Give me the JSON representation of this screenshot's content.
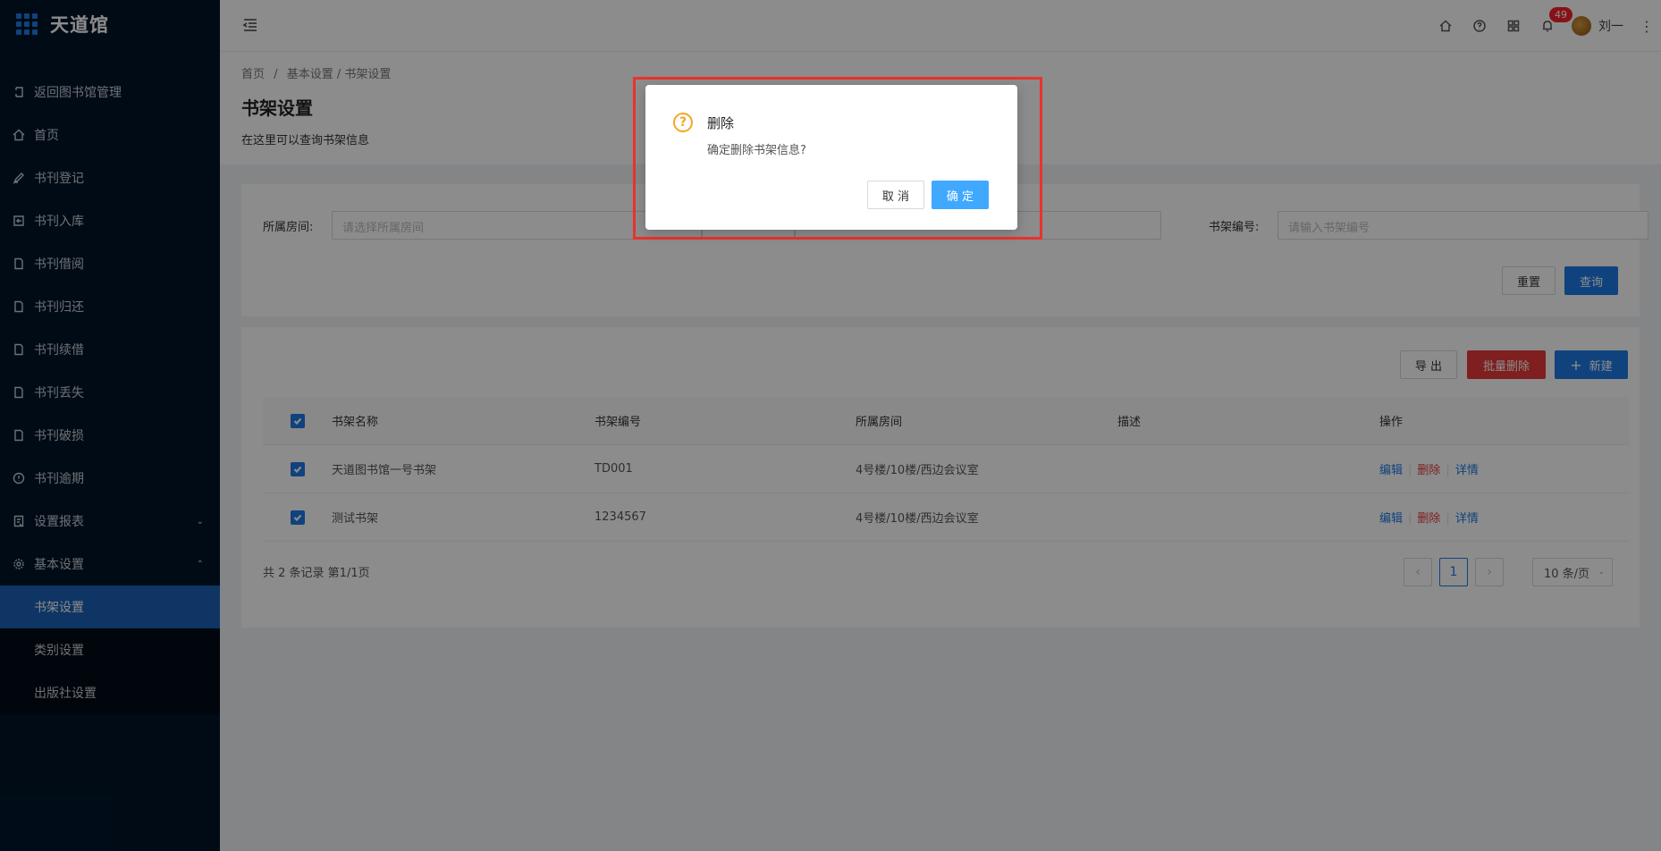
{
  "app": {
    "title": "天道馆"
  },
  "sidebar": {
    "items": [
      {
        "label": "返回图书馆管理",
        "icon": "back-icon"
      },
      {
        "label": "首页",
        "icon": "home-icon"
      },
      {
        "label": "书刊登记",
        "icon": "pen-icon"
      },
      {
        "label": "书刊入库",
        "icon": "import-icon"
      },
      {
        "label": "书刊借阅",
        "icon": "file-icon"
      },
      {
        "label": "书刊归还",
        "icon": "file-icon"
      },
      {
        "label": "书刊续借",
        "icon": "file-icon"
      },
      {
        "label": "书刊丢失",
        "icon": "file-icon"
      },
      {
        "label": "书刊破损",
        "icon": "file-icon"
      },
      {
        "label": "书刊逾期",
        "icon": "info-icon"
      },
      {
        "label": "设置报表",
        "icon": "report-icon"
      },
      {
        "label": "基本设置",
        "icon": "gear-icon"
      }
    ],
    "submenu": [
      {
        "label": "书架设置"
      },
      {
        "label": "类别设置"
      },
      {
        "label": "出版社设置"
      }
    ]
  },
  "header": {
    "notification_count": "49",
    "username": "刘一"
  },
  "breadcrumb": {
    "home": "首页",
    "sep": "/",
    "path": "基本设置 / 书架设置"
  },
  "page": {
    "title": "书架设置",
    "description": "在这里可以查询书架信息"
  },
  "search": {
    "room_label": "所属房间:",
    "room_placeholder": "请选择所属房间",
    "code_label": "书架编号:",
    "code_placeholder": "请输入书架编号",
    "reset_label": "重置",
    "query_label": "查询"
  },
  "toolbar": {
    "export_label": "导 出",
    "batch_delete_label": "批量删除",
    "new_label": "新建"
  },
  "table": {
    "columns": [
      "书架名称",
      "书架编号",
      "所属房间",
      "描述",
      "操作"
    ],
    "rows": [
      {
        "name": "天道图书馆一号书架",
        "code": "TD001",
        "room": "4号楼/10楼/西边会议室",
        "desc": ""
      },
      {
        "name": "测试书架",
        "code": "1234567",
        "room": "4号楼/10楼/西边会议室",
        "desc": ""
      }
    ],
    "ops": {
      "edit": "编辑",
      "delete": "删除",
      "detail": "详情"
    }
  },
  "pagination": {
    "summary": "共 2 条记录 第1/1页",
    "current_page": "1",
    "page_size": "10 条/页"
  },
  "modal": {
    "title": "删除",
    "body": "确定删除书架信息?",
    "cancel_label": "取 消",
    "ok_label": "确 定",
    "icon": "question-icon"
  },
  "colors": {
    "sidebar_bg": "#001529",
    "primary": "#1e78e6",
    "danger": "#e83a3a",
    "warning": "#f5a623",
    "highlight": "#e8332d"
  }
}
